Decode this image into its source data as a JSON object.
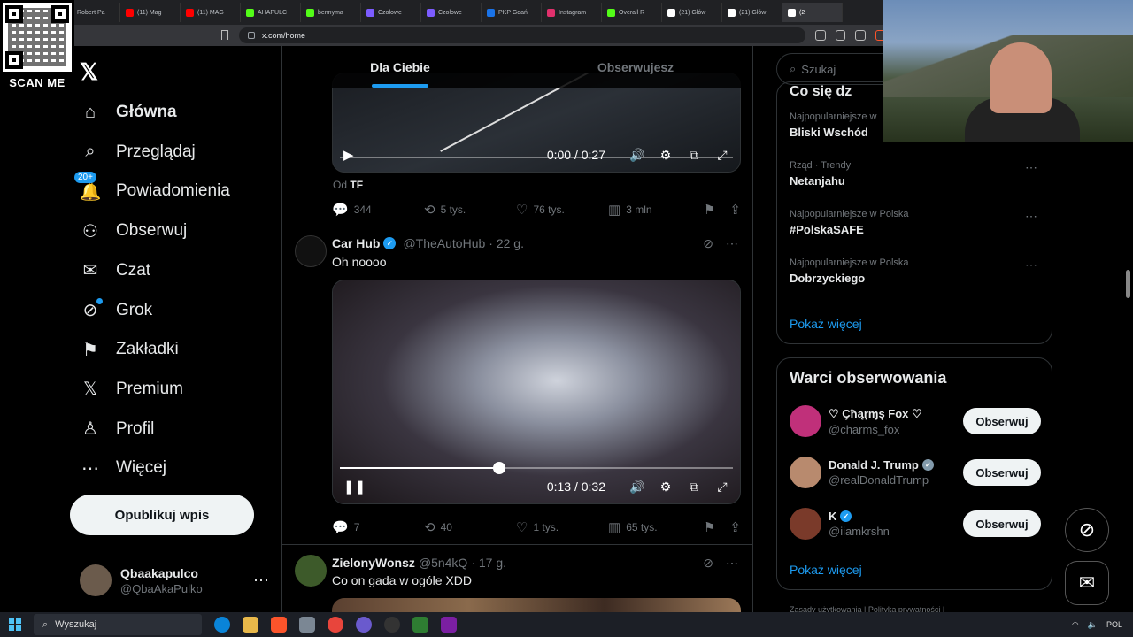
{
  "browser": {
    "tabs": [
      {
        "label": "(21) Głów",
        "color": "#ffffff"
      },
      {
        "label": "Robert Pa",
        "color": "#000000"
      },
      {
        "label": "(11) Mag",
        "color": "#ff0000"
      },
      {
        "label": "(11) MAG",
        "color": "#ff0000"
      },
      {
        "label": "AHAPULC",
        "color": "#53fc18"
      },
      {
        "label": "bennyma",
        "color": "#53fc18"
      },
      {
        "label": "Czołowe",
        "color": "#7c5cff"
      },
      {
        "label": "Czołowe",
        "color": "#7c5cff"
      },
      {
        "label": "PKP Gdań",
        "color": "#1a73e8"
      },
      {
        "label": "Instagram",
        "color": "#e1306c"
      },
      {
        "label": "Overall R",
        "color": "#53fc18"
      },
      {
        "label": "(21) Głów",
        "color": "#ffffff"
      },
      {
        "label": "(21) Głów",
        "color": "#ffffff"
      },
      {
        "label": "(2",
        "color": "#ffffff"
      }
    ],
    "url": "x.com/home"
  },
  "overlay": {
    "qr_label": "SCAN ME"
  },
  "nav": {
    "items": [
      {
        "label": "Główna",
        "icon": "home-icon",
        "glyph": "⌂"
      },
      {
        "label": "Przeglądaj",
        "icon": "search-icon",
        "glyph": "⌕"
      },
      {
        "label": "Powiadomienia",
        "icon": "bell-icon",
        "glyph": "🔔"
      },
      {
        "label": "Obserwuj",
        "icon": "add-user-icon",
        "glyph": "⚇"
      },
      {
        "label": "Czat",
        "icon": "mail-icon",
        "glyph": "✉"
      },
      {
        "label": "Grok",
        "icon": "grok-icon",
        "glyph": "⊘"
      },
      {
        "label": "Zakładki",
        "icon": "bookmark-icon",
        "glyph": "⚑"
      },
      {
        "label": "Premium",
        "icon": "x-premium-icon",
        "glyph": "𝕏"
      },
      {
        "label": "Profil",
        "icon": "profile-icon",
        "glyph": "♙"
      },
      {
        "label": "Więcej",
        "icon": "more-icon",
        "glyph": "⋯"
      }
    ],
    "notif_badge": "20+",
    "post_button": "Opublikuj wpis",
    "profile": {
      "name": "Qbaakapulco",
      "handle": "@QbaAkaPulko"
    }
  },
  "feed": {
    "tabs": [
      "Dla Ciebie",
      "Obserwujesz"
    ],
    "tweet1": {
      "video_time": "0:00 / 0:27",
      "from_prefix": "Od",
      "from_name": "TF",
      "replies": "344",
      "reposts": "5 tys.",
      "likes": "76 tys.",
      "views": "3 mln"
    },
    "tweet2": {
      "name": "Car Hub",
      "handle": "@TheAutoHub",
      "time": "· 22 g.",
      "text": "Oh noooo",
      "video_time": "0:13 / 0:32",
      "progress": 0.406,
      "replies": "7",
      "reposts": "40",
      "likes": "1 tys.",
      "views": "65 tys."
    },
    "tweet3": {
      "name": "ZielonyWonsz",
      "handle": "@5n4kQ",
      "time": "· 17 g.",
      "text": "Co on gada w ogóle XDD"
    }
  },
  "right": {
    "search_placeholder": "Szukaj",
    "trends_title": "Co się dz",
    "trends": [
      {
        "category": "Najpopularniejsze w",
        "title": "Bliski Wschód"
      },
      {
        "category": "Rząd · Trendy",
        "title": "Netanjahu"
      },
      {
        "category": "Najpopularniejsze w Polska",
        "title": "#PolskaSAFE"
      },
      {
        "category": "Najpopularniejsze w Polska",
        "title": "Dobrzyckiego"
      }
    ],
    "show_more": "Pokaż więcej",
    "follow_title": "Warci obserwowania",
    "follow": [
      {
        "name": "♡ Çħąṛɱș Fox ♡",
        "handle": "@charms_fox",
        "button": "Obserwuj",
        "avatar_color": "#c0307a"
      },
      {
        "name": "Donald J. Trump",
        "handle": "@realDonaldTrump",
        "button": "Obserwuj",
        "avatar_color": "#b88a6e",
        "badge_color": "#829aab"
      },
      {
        "name": "K",
        "handle": "@iiamkrshn",
        "button": "Obserwuj",
        "avatar_color": "#7a3a2a",
        "badge_color": "#1d9bf0"
      }
    ],
    "footer": "Zasady użytkowania  |  Polityka prywatności  |"
  },
  "taskbar": {
    "search": "Wyszukaj",
    "lang": "POL"
  }
}
